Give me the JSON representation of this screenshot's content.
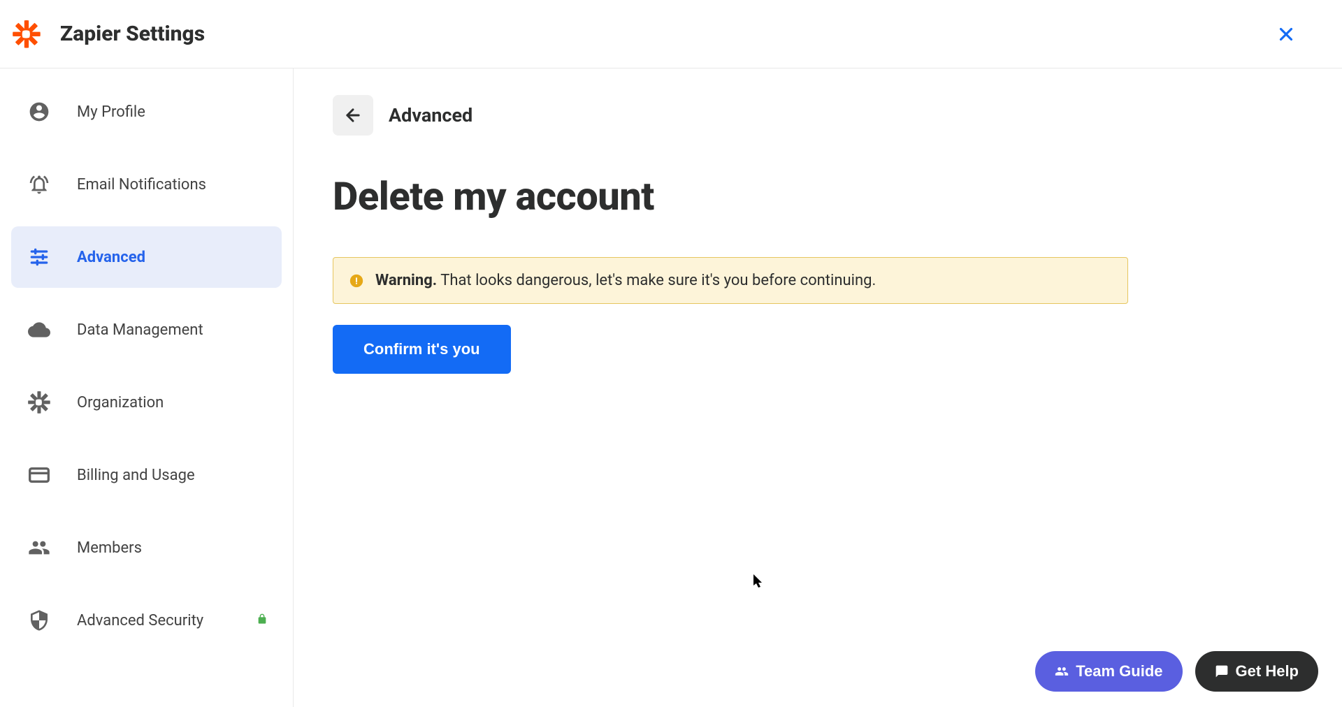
{
  "header": {
    "title": "Zapier Settings"
  },
  "sidebar": {
    "items": [
      {
        "label": "My Profile"
      },
      {
        "label": "Email Notifications"
      },
      {
        "label": "Advanced"
      },
      {
        "label": "Data Management"
      },
      {
        "label": "Organization"
      },
      {
        "label": "Billing and Usage"
      },
      {
        "label": "Members"
      },
      {
        "label": "Advanced Security"
      }
    ]
  },
  "main": {
    "breadcrumb_title": "Advanced",
    "page_heading": "Delete my account",
    "warning_prefix": "Warning.",
    "warning_text": " That looks dangerous, let's make sure it's you before continuing.",
    "confirm_label": "Confirm it's you"
  },
  "floating": {
    "team_guide": "Team Guide",
    "get_help": "Get Help"
  }
}
